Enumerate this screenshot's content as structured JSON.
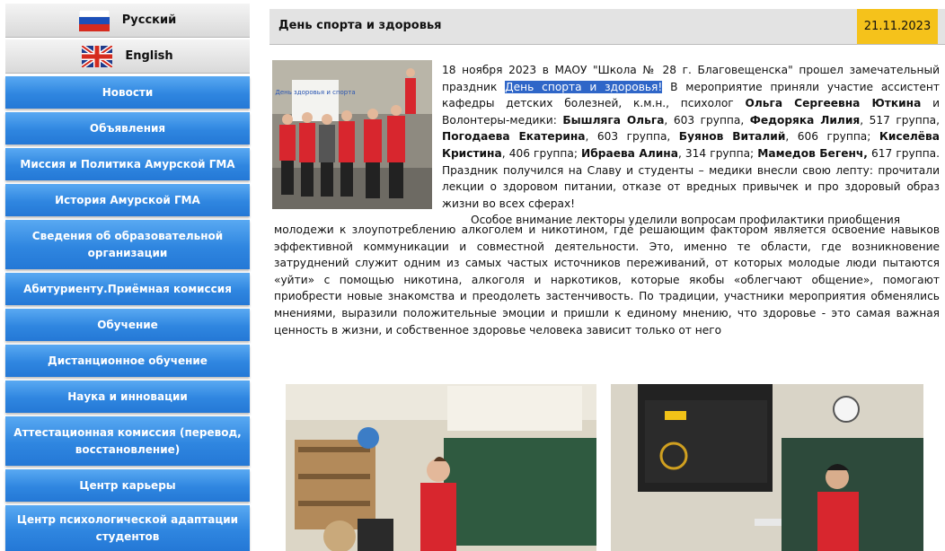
{
  "sidebar": {
    "languages": [
      {
        "label": "Русский",
        "icon": "russia-flag-icon"
      },
      {
        "label": "English",
        "icon": "uk-flag-icon"
      }
    ],
    "items": [
      "Новости",
      "Объявления",
      "Миссия и Политика Амурской ГМА",
      "История Амурской ГМА",
      "Сведения об образовательной организации",
      "Абитуриенту.Приёмная комиссия",
      "Обучение",
      "Дистанционное обучение",
      "Наука и инновации",
      "Аттестационная комиссия (перевод, восстановление)",
      "Центр карьеры",
      "Центр психологической адаптации студентов"
    ]
  },
  "article": {
    "title": "День спорта и здоровья",
    "date": "21.11.2023",
    "p1_a": "18 ноября 2023 в МАОУ \"Школа № 28 г. Благовещенска\" прошел замечательный праздник ",
    "p1_hl": "День спорта и здоровья!",
    "p1_b": " В мероприятие приняли участие ассистент кафедры детских болезней, к.м.н., психолог ",
    "p1_name1": "Ольга Сергеевна Юткина",
    "p1_c": " и Волонтеры-медики: ",
    "v1": "Бышляга Ольга",
    "v1g": ", 603 группа, ",
    "v2": "Федоряка Лилия",
    "v2g": ", 517 группа, ",
    "v3": "Погодаева Екатерина",
    "v3g": ", 603 группа, ",
    "v4": "Буянов Виталий",
    "v4g": ", 606 группа; ",
    "v5": "Киселёва Кристина",
    "v5g": ", 406 группа; ",
    "v6": "Ибраева Алина",
    "v6g": ", 314 группа; ",
    "v7": "Мамедов Бегенч,",
    "v7g": " 617 группа. Праздник получился на Славу и студенты – медики внесли свою лепту: прочитали лекции о здоровом питании, отказе от вредных привычек и про здоровый образ жизни во всех сферах!",
    "p2_first": "Особое внимание лекторы уделили вопросам профилактики приобщения",
    "p2_rest": "молодежи к злоупотреблению алкоголем и никотином, где решающим фактором является освоение навыков эффективной коммуникации и совместной деятельности. Это, именно те области, где возникновение затруднений служит одним из самых частых источников переживаний, от которых молодые люди пытаются «уйти» с помощью никотина, алкоголя и наркотиков, которые якобы «облегчают общение», помогают приобрести новые знакомства и преодолеть застенчивость. По традиции, участники мероприятия обменялись мнениями, выразили положительные эмоции и пришли к единому мнению, что здоровье - это самая важная ценность в жизни, и собственное здоровье человека зависит только от него",
    "poster_text": "День здоровья и спорта"
  },
  "colors": {
    "menu_blue": "#2f86e0",
    "date_bg": "#f5c21b",
    "highlight": "#2f66c8",
    "volunteer_red": "#d8262e"
  }
}
